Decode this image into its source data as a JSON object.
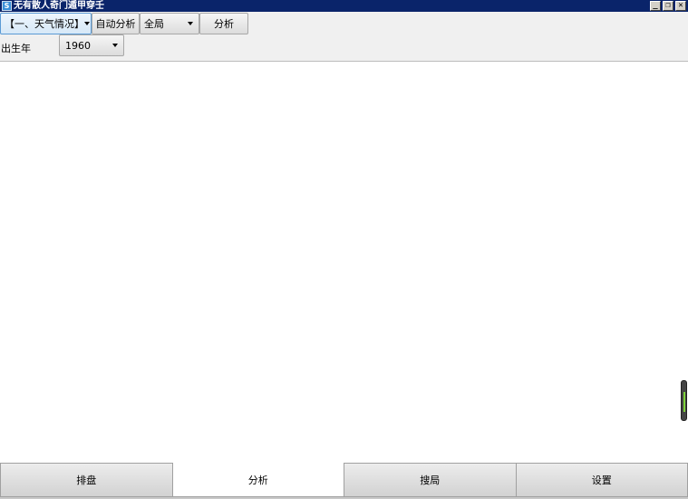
{
  "window": {
    "title": "无有散人奇门遁甲穿壬",
    "app_icon_glyph": "S",
    "controls": {
      "minimize": "_",
      "restore": "❐",
      "close": "✕"
    }
  },
  "toolbar": {
    "topic_select": {
      "value": "【一、天气情况】"
    },
    "auto_analyze_label": "自动分析",
    "scope_select": {
      "value": "全局"
    },
    "analyze_label": "分析",
    "birth_year_label": "出生年",
    "birth_year_select": {
      "value": "1960"
    }
  },
  "tabs": [
    {
      "label": "排盘",
      "active": false
    },
    {
      "label": "分析",
      "active": true
    },
    {
      "label": "搜局",
      "active": false
    },
    {
      "label": "设置",
      "active": false
    }
  ],
  "colors": {
    "titlebar": "#0a246a",
    "panel": "#f0f0f0",
    "indicator": "#7fd43a"
  }
}
